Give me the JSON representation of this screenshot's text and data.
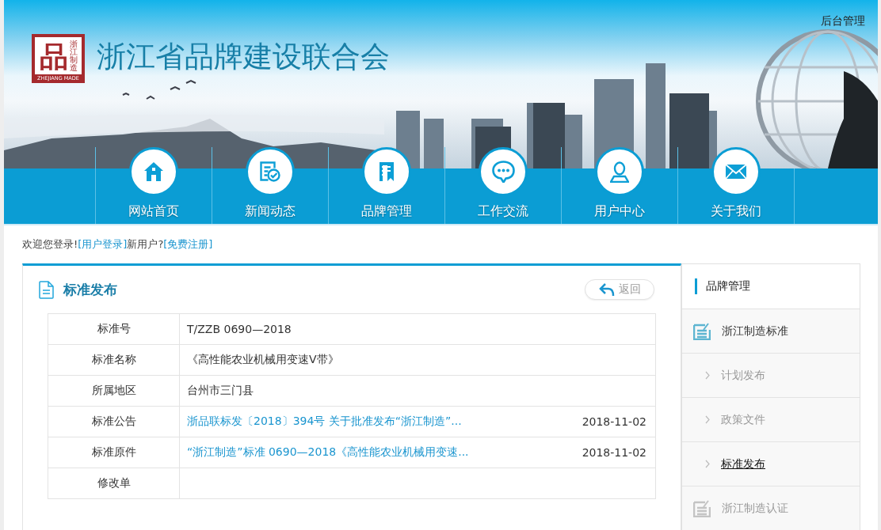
{
  "header_link": "后台管理",
  "logo": {
    "mark": "品",
    "side_text": "浙江制造",
    "caption": "ZHEJIANG MADE"
  },
  "site_title": "浙江省品牌建设联合会",
  "nav": [
    {
      "label": "网站首页"
    },
    {
      "label": "新闻动态"
    },
    {
      "label": "品牌管理"
    },
    {
      "label": "工作交流"
    },
    {
      "label": "用户中心"
    },
    {
      "label": "关于我们"
    }
  ],
  "welcome": {
    "greeting": "欢迎您登录!",
    "login_link": "[用户登录]",
    "new_user": "新用户?",
    "register_link": "[免费注册]"
  },
  "panel": {
    "title": "标准发布",
    "back_button": "返回",
    "rows": [
      {
        "label": "标准号",
        "kind": "text",
        "value": "T/ZZB 0690—2018"
      },
      {
        "label": "标准名称",
        "kind": "text",
        "value": "《高性能农业机械用变速V带》"
      },
      {
        "label": "所属地区",
        "kind": "text",
        "value": "台州市三门县"
      },
      {
        "label": "标准公告",
        "kind": "link",
        "value": "浙品联标发〔2018〕394号 关于批准发布“浙江制造”...",
        "date": "2018-11-02"
      },
      {
        "label": "标准原件",
        "kind": "link",
        "value": "“浙江制造”标准 0690—2018《高性能农业机械用变速...",
        "date": "2018-11-02"
      },
      {
        "label": "修改单",
        "kind": "empty"
      }
    ]
  },
  "sidebar": {
    "title": "品牌管理",
    "items": [
      {
        "label": "浙江制造标准",
        "expanded": true,
        "children": [
          {
            "label": "计划发布",
            "selected": false
          },
          {
            "label": "政策文件",
            "selected": false
          },
          {
            "label": "标准发布",
            "selected": true
          }
        ]
      },
      {
        "label": "浙江制造认证",
        "expanded": false
      }
    ]
  }
}
